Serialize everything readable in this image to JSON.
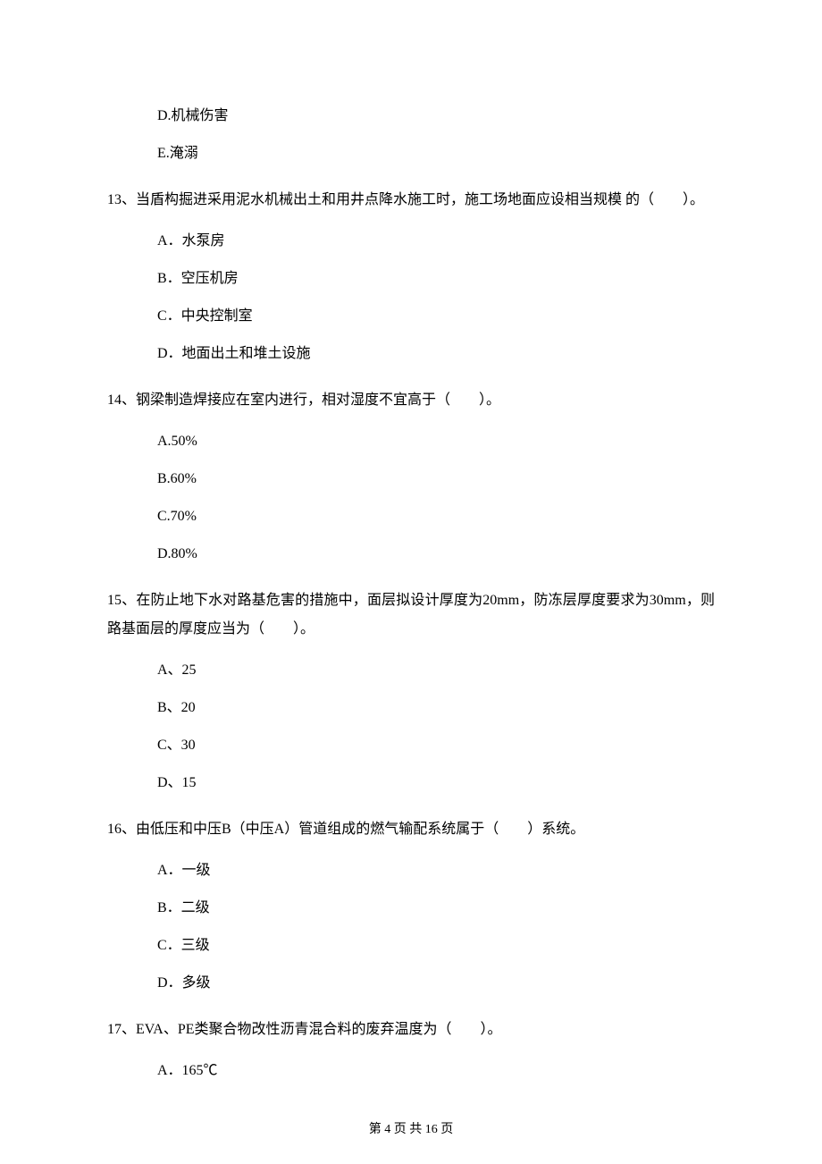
{
  "prev_options": {
    "D": "D.机械伤害",
    "E": "E.淹溺"
  },
  "q13": {
    "text": "13、当盾构掘进采用泥水机械出土和用井点降水施工时，施工场地面应设相当规模 的（　　）。",
    "A": "A．水泵房",
    "B": "B．空压机房",
    "C": "C．中央控制室",
    "D": "D．地面出土和堆土设施"
  },
  "q14": {
    "text": "14、钢梁制造焊接应在室内进行，相对湿度不宜高于（　　）。",
    "A": "A.50%",
    "B": "B.60%",
    "C": "C.70%",
    "D": "D.80%"
  },
  "q15": {
    "text": "15、在防止地下水对路基危害的措施中，面层拟设计厚度为20mm，防冻层厚度要求为30mm，则路基面层的厚度应当为（　　）。",
    "A": "A、25",
    "B": "B、20",
    "C": "C、30",
    "D": "D、15"
  },
  "q16": {
    "text": "16、由低压和中压B（中压A）管道组成的燃气输配系统属于（　　）系统。",
    "A": "A．一级",
    "B": "B．二级",
    "C": "C．三级",
    "D": "D．多级"
  },
  "q17": {
    "text": "17、EVA、PE类聚合物改性沥青混合料的废弃温度为（　　）。",
    "A": "A．165℃"
  },
  "footer": "第 4 页 共 16 页"
}
